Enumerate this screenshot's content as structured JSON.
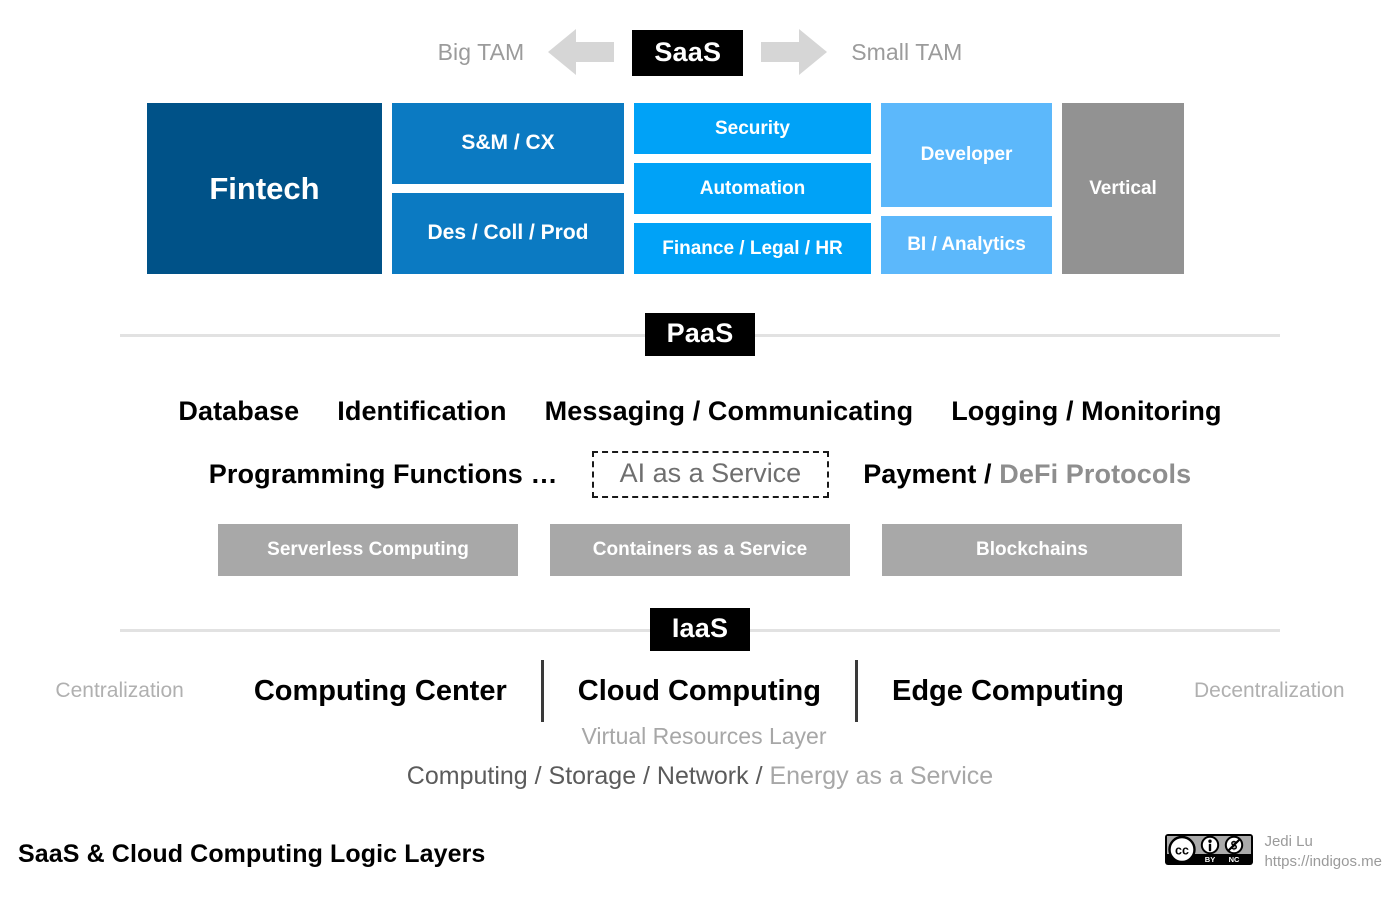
{
  "colors": {
    "background": "#ffffff",
    "fintech_blue": "#005288",
    "medium_blue": "#0B7AC2",
    "bright_blue": "#00A2F7",
    "light_blue": "#5CB8FB",
    "gray_vertical": "#929292",
    "gray_pill": "#a8a8a8",
    "chip_black": "#000000",
    "muted_text": "#9b9b9b",
    "divider_line": "#e2e2e2"
  },
  "tam_bar": {
    "left_label": "Big TAM",
    "right_label": "Small TAM",
    "chip": "SaaS",
    "left_arrow_icon": "arrow-left-icon",
    "right_arrow_icon": "arrow-right-icon"
  },
  "saas": {
    "columns": [
      {
        "name": "fintech",
        "cells": [
          {
            "label": "Fintech",
            "color": "#005288",
            "size": "fintech"
          }
        ]
      },
      {
        "name": "sales-marketing",
        "cells": [
          {
            "label": "S&M / CX",
            "color": "#0B7AC2",
            "size": "big"
          },
          {
            "label": "Des / Coll / Prod",
            "color": "#0B7AC2",
            "size": "big"
          }
        ]
      },
      {
        "name": "security-automation",
        "cells": [
          {
            "label": "Security",
            "color": "#00A2F7",
            "size": "mid"
          },
          {
            "label": "Automation",
            "color": "#00A2F7",
            "size": "mid"
          },
          {
            "label": "Finance / Legal / HR",
            "color": "#00A2F7",
            "size": "mid"
          }
        ]
      },
      {
        "name": "developer-bi",
        "cells": [
          {
            "label": "Developer",
            "color": "#5CB8FB",
            "size": "mid"
          },
          {
            "label": "BI / Analytics",
            "color": "#5CB8FB",
            "size": "mid"
          }
        ]
      },
      {
        "name": "vertical",
        "cells": [
          {
            "label": "Vertical",
            "color": "#929292",
            "size": "vertical"
          }
        ]
      }
    ]
  },
  "paas": {
    "chip": "PaaS",
    "row1": [
      "Database",
      "Identification",
      "Messaging / Communicating",
      "Logging / Monitoring"
    ],
    "row2": {
      "programming": "Programming Functions …",
      "ai_service": "AI as a Service",
      "payment": "Payment / ",
      "defi": "DeFi Protocols"
    },
    "pills": [
      "Serverless Computing",
      "Containers as a Service",
      "Blockchains"
    ]
  },
  "iaas": {
    "chip": "IaaS",
    "left_label": "Centralization",
    "right_label": "Decentralization",
    "terms": [
      "Computing Center",
      "Cloud Computing",
      "Edge Computing"
    ],
    "virtual_resources_layer": "Virtual Resources Layer",
    "stack_line": {
      "dark": "Computing / Storage / Network / ",
      "light": "Energy as a Service"
    }
  },
  "footer": {
    "title": "SaaS & Cloud Computing Logic Layers",
    "license_icon": "creative-commons-by-nc-icon",
    "author": "Jedi Lu",
    "url": "https://indigos.me"
  }
}
